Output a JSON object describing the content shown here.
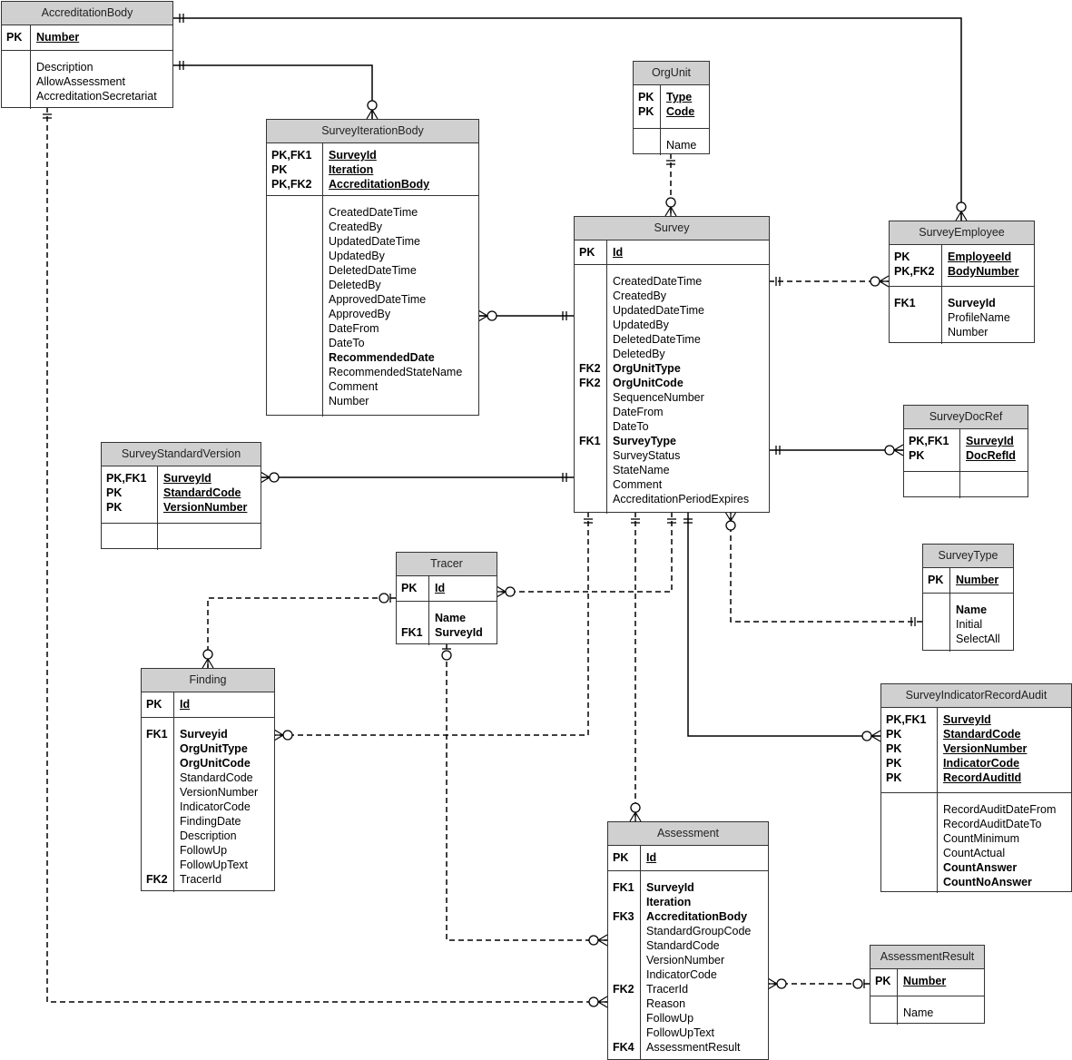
{
  "entities": [
    {
      "id": "AccreditationBody",
      "title": "AccreditationBody",
      "pk": [
        {
          "key": "PK",
          "name": "Number"
        }
      ],
      "attrs": [
        {
          "key": "",
          "name": "Description"
        },
        {
          "key": "",
          "name": "AllowAssessment"
        },
        {
          "key": "",
          "name": "AccreditationSecretariat"
        }
      ]
    },
    {
      "id": "SurveyIterationBody",
      "title": "SurveyIterationBody",
      "pk": [
        {
          "key": "PK,FK1",
          "name": "SurveyId"
        },
        {
          "key": "PK",
          "name": "Iteration"
        },
        {
          "key": "PK,FK2",
          "name": "AccreditationBody"
        }
      ],
      "attrs": [
        {
          "key": "",
          "name": "CreatedDateTime"
        },
        {
          "key": "",
          "name": "CreatedBy"
        },
        {
          "key": "",
          "name": "UpdatedDateTime"
        },
        {
          "key": "",
          "name": "UpdatedBy"
        },
        {
          "key": "",
          "name": "DeletedDateTime"
        },
        {
          "key": "",
          "name": "DeletedBy"
        },
        {
          "key": "",
          "name": "ApprovedDateTime"
        },
        {
          "key": "",
          "name": "ApprovedBy"
        },
        {
          "key": "",
          "name": "DateFrom"
        },
        {
          "key": "",
          "name": "DateTo"
        },
        {
          "key": "",
          "name": "RecommendedDate",
          "bold": true
        },
        {
          "key": "",
          "name": "RecommendedStateName"
        },
        {
          "key": "",
          "name": "Comment"
        },
        {
          "key": "",
          "name": "Number"
        }
      ]
    },
    {
      "id": "OrgUnit",
      "title": "OrgUnit",
      "pk": [
        {
          "key": "PK",
          "name": "Type"
        },
        {
          "key": "PK",
          "name": "Code"
        }
      ],
      "attrs": [
        {
          "key": "",
          "name": "Name"
        }
      ]
    },
    {
      "id": "Survey",
      "title": "Survey",
      "pk": [
        {
          "key": "PK",
          "name": "Id"
        }
      ],
      "attrs": [
        {
          "key": "",
          "name": "CreatedDateTime"
        },
        {
          "key": "",
          "name": "CreatedBy"
        },
        {
          "key": "",
          "name": "UpdatedDateTime"
        },
        {
          "key": "",
          "name": "UpdatedBy"
        },
        {
          "key": "",
          "name": "DeletedDateTime"
        },
        {
          "key": "",
          "name": "DeletedBy"
        },
        {
          "key": "FK2",
          "name": "OrgUnitType",
          "bold": true
        },
        {
          "key": "FK2",
          "name": "OrgUnitCode",
          "bold": true
        },
        {
          "key": "",
          "name": "SequenceNumber"
        },
        {
          "key": "",
          "name": "DateFrom"
        },
        {
          "key": "",
          "name": "DateTo"
        },
        {
          "key": "FK1",
          "name": "SurveyType",
          "bold": true
        },
        {
          "key": "",
          "name": "SurveyStatus"
        },
        {
          "key": "",
          "name": "StateName"
        },
        {
          "key": "",
          "name": "Comment"
        },
        {
          "key": "",
          "name": "AccreditationPeriodExpires"
        }
      ]
    },
    {
      "id": "SurveyEmployee",
      "title": "SurveyEmployee",
      "pk": [
        {
          "key": "PK",
          "name": "EmployeeId"
        },
        {
          "key": "PK,FK2",
          "name": "BodyNumber"
        }
      ],
      "attrs": [
        {
          "key": "FK1",
          "name": "SurveyId",
          "bold": true
        },
        {
          "key": "",
          "name": "ProfileName"
        },
        {
          "key": "",
          "name": "Number"
        }
      ]
    },
    {
      "id": "SurveyDocRef",
      "title": "SurveyDocRef",
      "pk": [
        {
          "key": "PK,FK1",
          "name": "SurveyId"
        },
        {
          "key": "PK",
          "name": "DocRefId"
        }
      ],
      "attrs": []
    },
    {
      "id": "SurveyStandardVersion",
      "title": "SurveyStandardVersion",
      "pk": [
        {
          "key": "PK,FK1",
          "name": "SurveyId"
        },
        {
          "key": "PK",
          "name": "StandardCode"
        },
        {
          "key": "PK",
          "name": "VersionNumber"
        }
      ],
      "attrs": []
    },
    {
      "id": "Tracer",
      "title": "Tracer",
      "pk": [
        {
          "key": "PK",
          "name": "Id"
        }
      ],
      "attrs": [
        {
          "key": "",
          "name": "Name",
          "bold": true
        },
        {
          "key": "FK1",
          "name": "SurveyId",
          "bold": true
        }
      ]
    },
    {
      "id": "SurveyType",
      "title": "SurveyType",
      "pk": [
        {
          "key": "PK",
          "name": "Number"
        }
      ],
      "attrs": [
        {
          "key": "",
          "name": "Name",
          "bold": true
        },
        {
          "key": "",
          "name": "Initial"
        },
        {
          "key": "",
          "name": "SelectAll"
        }
      ]
    },
    {
      "id": "Finding",
      "title": "Finding",
      "pk": [
        {
          "key": "PK",
          "name": "Id"
        }
      ],
      "attrs": [
        {
          "key": "FK1",
          "name": "Surveyid",
          "bold": true
        },
        {
          "key": "",
          "name": "OrgUnitType",
          "bold": true
        },
        {
          "key": "",
          "name": "OrgUnitCode",
          "bold": true
        },
        {
          "key": "",
          "name": "StandardCode"
        },
        {
          "key": "",
          "name": "VersionNumber"
        },
        {
          "key": "",
          "name": "IndicatorCode"
        },
        {
          "key": "",
          "name": "FindingDate"
        },
        {
          "key": "",
          "name": "Description"
        },
        {
          "key": "",
          "name": "FollowUp"
        },
        {
          "key": "",
          "name": "FollowUpText"
        },
        {
          "key": "FK2",
          "name": "TracerId"
        }
      ]
    },
    {
      "id": "SurveyIndicatorRecordAudit",
      "title": "SurveyIndicatorRecordAudit",
      "pk": [
        {
          "key": "PK,FK1",
          "name": "SurveyId"
        },
        {
          "key": "PK",
          "name": "StandardCode"
        },
        {
          "key": "PK",
          "name": "VersionNumber"
        },
        {
          "key": "PK",
          "name": "IndicatorCode"
        },
        {
          "key": "PK",
          "name": "RecordAuditId"
        }
      ],
      "attrs": [
        {
          "key": "",
          "name": "RecordAuditDateFrom"
        },
        {
          "key": "",
          "name": "RecordAuditDateTo"
        },
        {
          "key": "",
          "name": "CountMinimum"
        },
        {
          "key": "",
          "name": "CountActual"
        },
        {
          "key": "",
          "name": "CountAnswer",
          "bold": true
        },
        {
          "key": "",
          "name": "CountNoAnswer",
          "bold": true
        }
      ]
    },
    {
      "id": "Assessment",
      "title": "Assessment",
      "pk": [
        {
          "key": "PK",
          "name": "Id"
        }
      ],
      "attrs": [
        {
          "key": "FK1",
          "name": "SurveyId",
          "bold": true
        },
        {
          "key": "",
          "name": "Iteration",
          "bold": true
        },
        {
          "key": "FK3",
          "name": "AccreditationBody",
          "bold": true
        },
        {
          "key": "",
          "name": "StandardGroupCode"
        },
        {
          "key": "",
          "name": "StandardCode"
        },
        {
          "key": "",
          "name": "VersionNumber"
        },
        {
          "key": "",
          "name": "IndicatorCode"
        },
        {
          "key": "FK2",
          "name": "TracerId"
        },
        {
          "key": "",
          "name": "Reason"
        },
        {
          "key": "",
          "name": "FollowUp"
        },
        {
          "key": "",
          "name": "FollowUpText"
        },
        {
          "key": "FK4",
          "name": "AssessmentResult"
        }
      ]
    },
    {
      "id": "AssessmentResult",
      "title": "AssessmentResult",
      "pk": [
        {
          "key": "PK",
          "name": "Number"
        }
      ],
      "attrs": [
        {
          "key": "",
          "name": "Name"
        }
      ]
    }
  ],
  "relationships": [
    {
      "from": "AccreditationBody",
      "to": "SurveyEmployee",
      "from_card": "one",
      "to_card": "zero-many",
      "style": "solid"
    },
    {
      "from": "AccreditationBody",
      "to": "SurveyIterationBody",
      "from_card": "one",
      "to_card": "zero-many",
      "style": "solid"
    },
    {
      "from": "AccreditationBody",
      "to": "Assessment",
      "from_card": "one",
      "to_card": "zero-many",
      "style": "dashed"
    },
    {
      "from": "OrgUnit",
      "to": "Survey",
      "from_card": "one",
      "to_card": "zero-many",
      "style": "dashed"
    },
    {
      "from": "Survey",
      "to": "SurveyIterationBody",
      "from_card": "one",
      "to_card": "zero-many",
      "style": "solid"
    },
    {
      "from": "Survey",
      "to": "SurveyEmployee",
      "from_card": "one",
      "to_card": "zero-many",
      "style": "dashed"
    },
    {
      "from": "Survey",
      "to": "SurveyDocRef",
      "from_card": "one",
      "to_card": "zero-many",
      "style": "solid"
    },
    {
      "from": "Survey",
      "to": "SurveyStandardVersion",
      "from_card": "one",
      "to_card": "zero-many",
      "style": "solid"
    },
    {
      "from": "Survey",
      "to": "Tracer",
      "from_card": "one",
      "to_card": "zero-many",
      "style": "dashed"
    },
    {
      "from": "Survey",
      "to": "Finding",
      "from_card": "one",
      "to_card": "zero-many",
      "style": "dashed"
    },
    {
      "from": "Survey",
      "to": "Assessment",
      "from_card": "one",
      "to_card": "zero-many",
      "style": "dashed"
    },
    {
      "from": "Survey",
      "to": "SurveyIndicatorRecordAudit",
      "from_card": "one",
      "to_card": "zero-many",
      "style": "solid"
    },
    {
      "from": "SurveyType",
      "to": "Survey",
      "from_card": "one",
      "to_card": "zero-many",
      "style": "dashed"
    },
    {
      "from": "Tracer",
      "to": "Finding",
      "from_card": "zero-one",
      "to_card": "zero-many",
      "style": "dashed"
    },
    {
      "from": "Tracer",
      "to": "Assessment",
      "from_card": "zero-one",
      "to_card": "zero-many",
      "style": "dashed"
    },
    {
      "from": "AssessmentResult",
      "to": "Assessment",
      "from_card": "zero-one",
      "to_card": "zero-many",
      "style": "dashed"
    }
  ],
  "colors": {
    "header": "#d0d0d0",
    "border": "#333333",
    "line": "#000000"
  }
}
